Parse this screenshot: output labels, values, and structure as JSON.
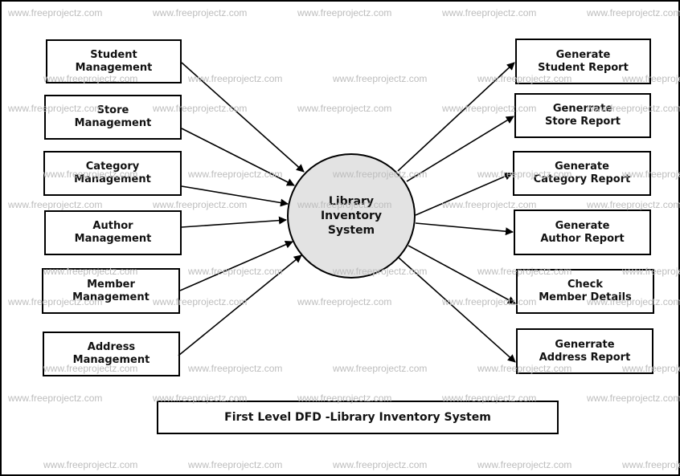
{
  "diagram": {
    "type": "Data Flow Diagram",
    "center_process": {
      "label_lines": [
        "Library",
        "Inventory",
        "System"
      ],
      "fill": "#e3e3e3"
    },
    "inputs": [
      {
        "id": "student",
        "label_lines": [
          "Student",
          "Management"
        ]
      },
      {
        "id": "store",
        "label_lines": [
          "Store",
          "Management"
        ]
      },
      {
        "id": "category",
        "label_lines": [
          "Category",
          "Management"
        ]
      },
      {
        "id": "author",
        "label_lines": [
          "Author",
          "Management"
        ]
      },
      {
        "id": "member",
        "label_lines": [
          "Member",
          "Management"
        ]
      },
      {
        "id": "address",
        "label_lines": [
          "Address",
          "Management"
        ]
      }
    ],
    "outputs": [
      {
        "id": "student-report",
        "label_lines": [
          "Generate",
          "Student Report"
        ]
      },
      {
        "id": "store-report",
        "label_lines": [
          "Generrate",
          "Store Report"
        ]
      },
      {
        "id": "category-report",
        "label_lines": [
          "Generate",
          "Category Report"
        ]
      },
      {
        "id": "author-report",
        "label_lines": [
          "Generate",
          "Author Report"
        ]
      },
      {
        "id": "member-details",
        "label_lines": [
          "Check",
          "Member Details"
        ]
      },
      {
        "id": "address-report",
        "label_lines": [
          "Generrate",
          "Address Report"
        ]
      }
    ],
    "flows": [
      {
        "from": "student",
        "to": "center"
      },
      {
        "from": "store",
        "to": "center"
      },
      {
        "from": "category",
        "to": "center"
      },
      {
        "from": "author",
        "to": "center"
      },
      {
        "from": "member",
        "to": "center"
      },
      {
        "from": "address",
        "to": "center"
      },
      {
        "from": "center",
        "to": "student-report"
      },
      {
        "from": "center",
        "to": "store-report"
      },
      {
        "from": "center",
        "to": "category-report"
      },
      {
        "from": "center",
        "to": "author-report"
      },
      {
        "from": "center",
        "to": "member-details"
      },
      {
        "from": "center",
        "to": "address-report"
      }
    ],
    "caption": "First Level DFD -Library Inventory System",
    "watermark": "www.freeprojectz.com"
  }
}
